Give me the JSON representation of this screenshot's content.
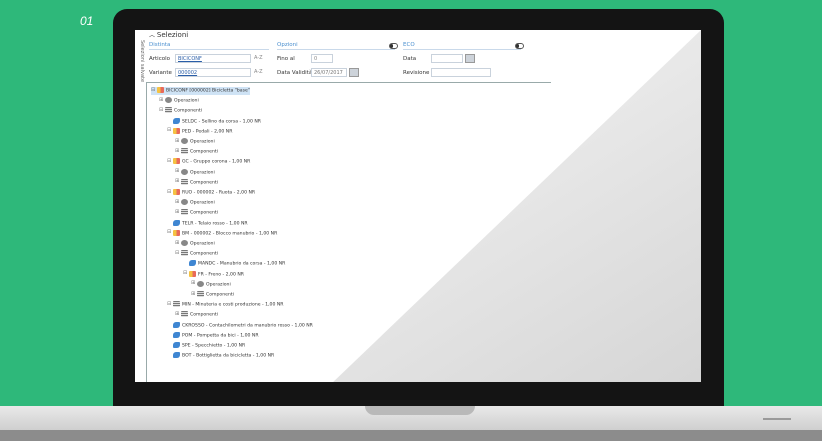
{
  "slide_number": "01",
  "screen": {
    "side_tab": "Selezioni salvate",
    "title": "Selezioni",
    "sections": {
      "distinta": "Distinta",
      "opzioni": "Opzioni",
      "eco": "ECO"
    },
    "fields": {
      "articolo_label": "Articolo",
      "articolo_value": "BICICONF",
      "variante_label": "Variante",
      "variante_value": "000002",
      "az_icon": "A-Z",
      "fino_al_label": "Fino al",
      "fino_al_value": "0",
      "data_validita_label": "Data Validità",
      "data_validita_value": "26/07/2017",
      "data_label": "Data",
      "revisione_label": "Revisione"
    },
    "tree": [
      {
        "level": 0,
        "type": "bom",
        "text": "BICICONF [000002] Bicicletta \"base\"",
        "expander": "⊟",
        "selected": true
      },
      {
        "level": 1,
        "type": "gear",
        "text": "Operazioni",
        "expander": "⊞"
      },
      {
        "level": 1,
        "type": "comp",
        "text": "Componenti",
        "expander": "⊟"
      },
      {
        "level": 2,
        "type": "part",
        "text": "SELDC - Sellino da corsa - 1,00 NR",
        "expander": ""
      },
      {
        "level": 2,
        "type": "bom",
        "text": "PED - Pedali - 2,00 NR",
        "expander": "⊟"
      },
      {
        "level": 3,
        "type": "gear",
        "text": "Operazioni",
        "expander": "⊞"
      },
      {
        "level": 3,
        "type": "comp",
        "text": "Componenti",
        "expander": "⊞"
      },
      {
        "level": 2,
        "type": "bom",
        "text": "GC - Gruppo corona - 1,00 NR",
        "expander": "⊟"
      },
      {
        "level": 3,
        "type": "gear",
        "text": "Operazioni",
        "expander": "⊞"
      },
      {
        "level": 3,
        "type": "comp",
        "text": "Componenti",
        "expander": "⊞"
      },
      {
        "level": 2,
        "type": "bom",
        "text": "RUO - 000002 - Ruota - 2,00 NR",
        "expander": "⊟"
      },
      {
        "level": 3,
        "type": "gear",
        "text": "Operazioni",
        "expander": "⊞"
      },
      {
        "level": 3,
        "type": "comp",
        "text": "Componenti",
        "expander": "⊞"
      },
      {
        "level": 2,
        "type": "part",
        "text": "TELR - Telaio rosso - 1,00 NR",
        "expander": ""
      },
      {
        "level": 2,
        "type": "bom",
        "text": "BM - 000002 - Blocco manubrio - 1,00 NR",
        "expander": "⊟"
      },
      {
        "level": 3,
        "type": "gear",
        "text": "Operazioni",
        "expander": "⊞"
      },
      {
        "level": 3,
        "type": "comp",
        "text": "Componenti",
        "expander": "⊟"
      },
      {
        "level": 4,
        "type": "part",
        "text": "MANDC - Manubrio da corsa - 1,00 NR",
        "expander": ""
      },
      {
        "level": 4,
        "type": "bom",
        "text": "FR - Freno - 2,00 NR",
        "expander": "⊟"
      },
      {
        "level": 5,
        "type": "gear",
        "text": "Operazioni",
        "expander": "⊞"
      },
      {
        "level": 5,
        "type": "comp",
        "text": "Componenti",
        "expander": "⊞"
      },
      {
        "level": 2,
        "type": "comp",
        "text": "MIN - Minuteria e costi produzione - 1,00 NR",
        "expander": "⊟"
      },
      {
        "level": 3,
        "type": "comp",
        "text": "Componenti",
        "expander": "⊞"
      },
      {
        "level": 2,
        "type": "part",
        "text": "CKROSSO - Contachilometri da manubrio rosso - 1,00 NR",
        "expander": ""
      },
      {
        "level": 2,
        "type": "part",
        "text": "POM - Pompetta da bici - 1,00 NR",
        "expander": ""
      },
      {
        "level": 2,
        "type": "part",
        "text": "SPE - Specchietto - 1,00 NR",
        "expander": ""
      },
      {
        "level": 2,
        "type": "part",
        "text": "BOT - Bottiglietta da bicicletta - 1,00 NR",
        "expander": ""
      }
    ]
  },
  "colors": {
    "background": "#2eb87a",
    "accent": "#4a8fcf"
  }
}
